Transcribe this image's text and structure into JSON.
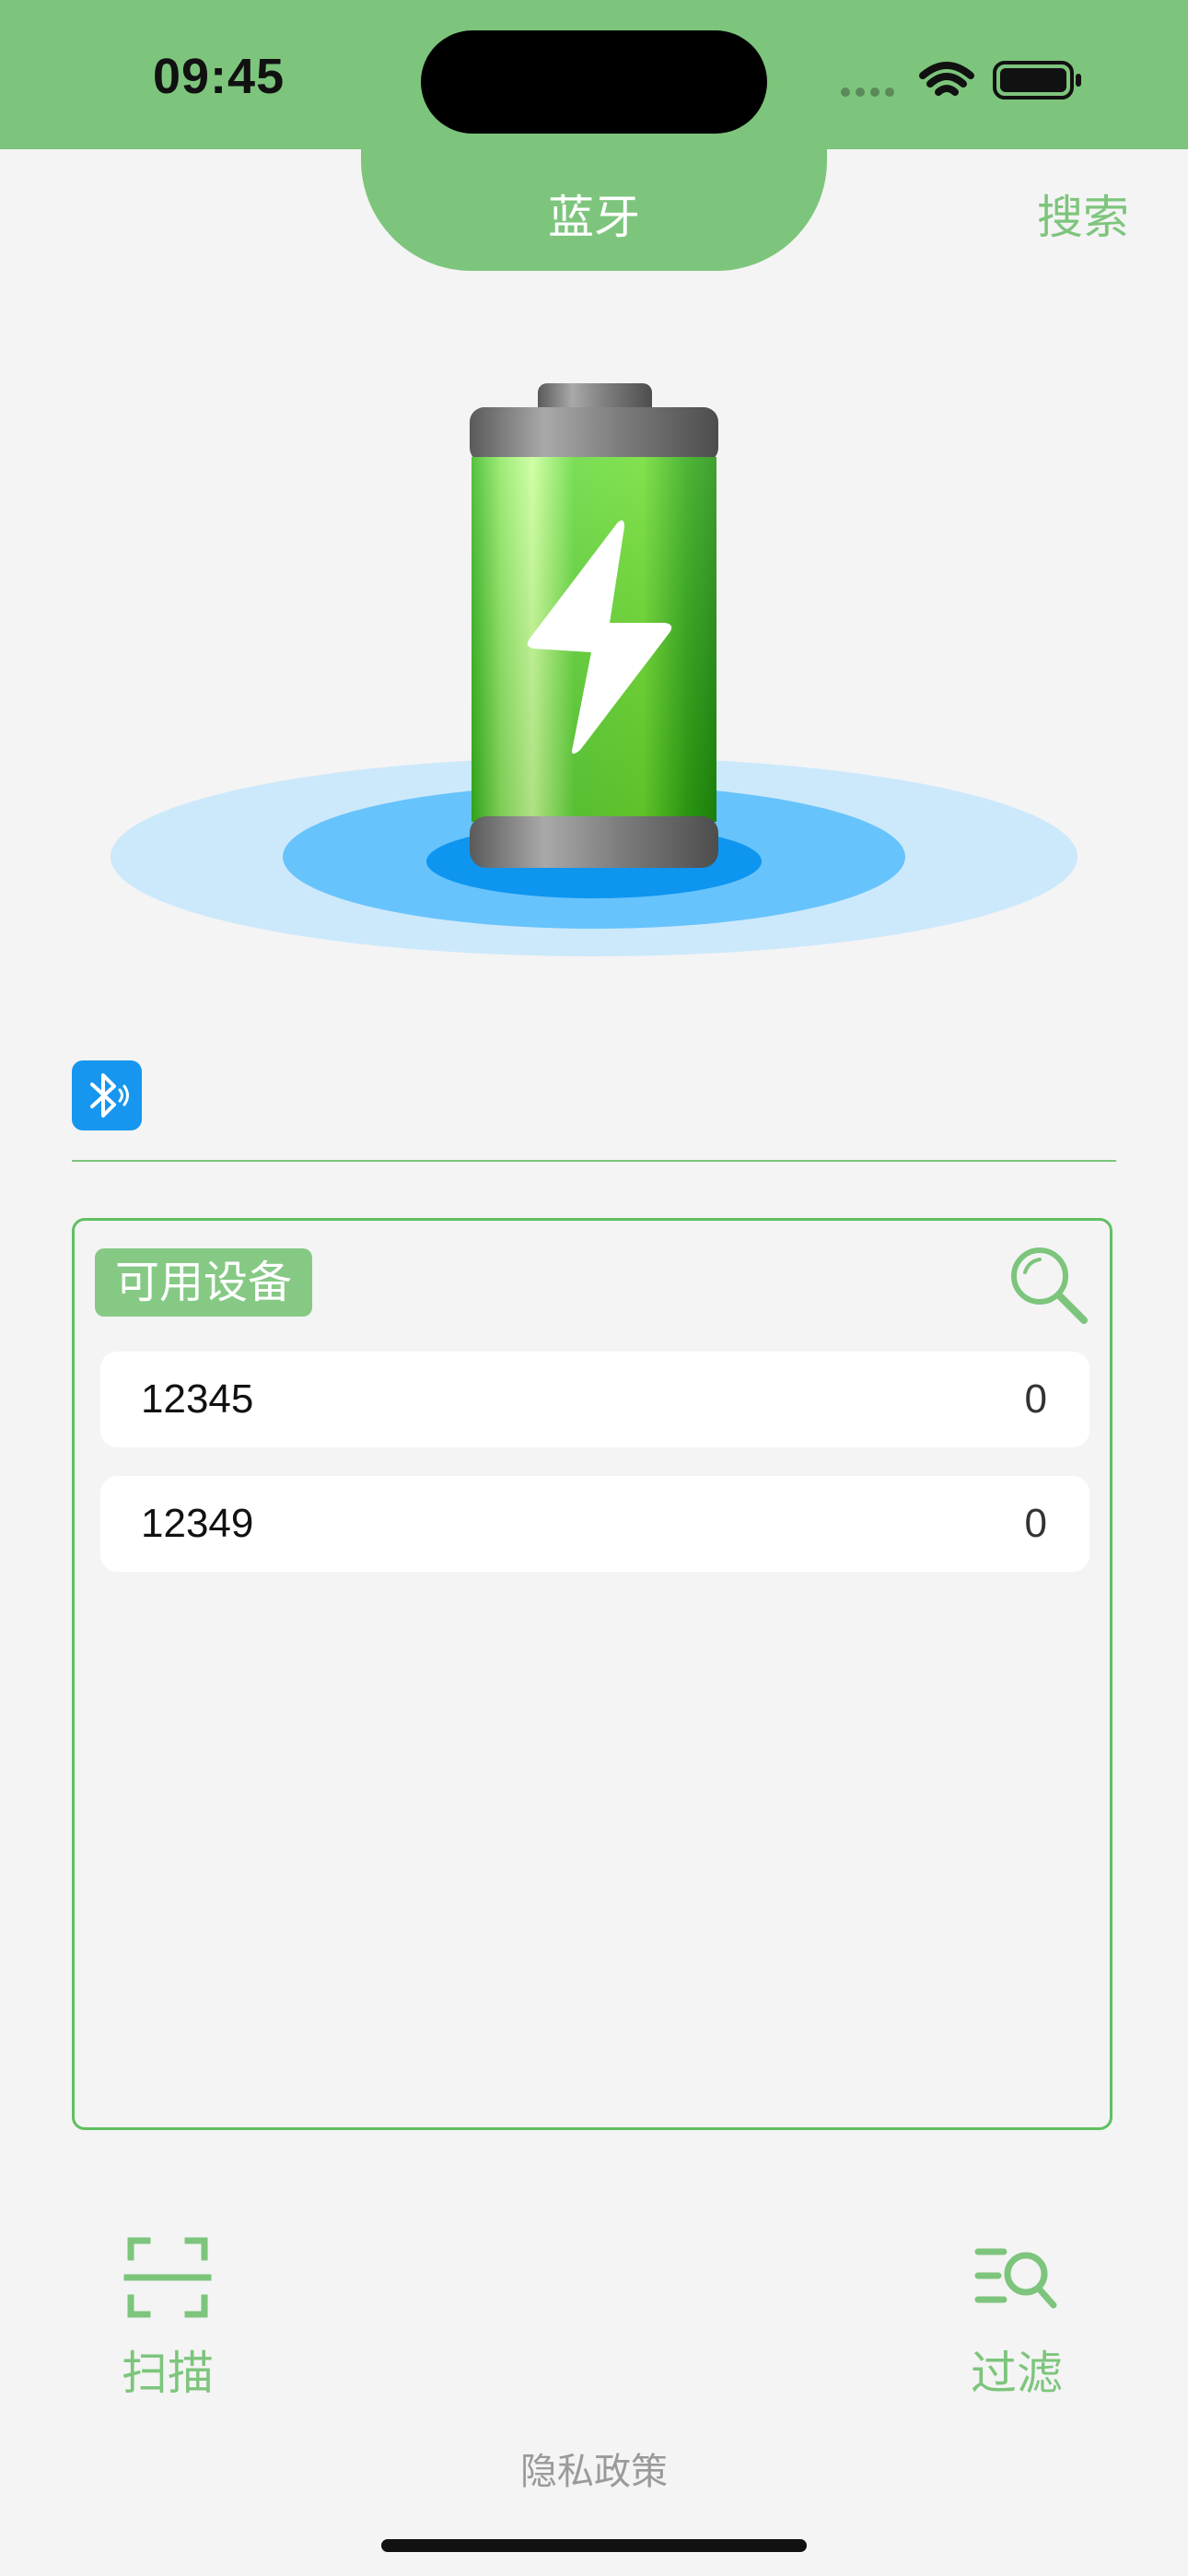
{
  "status_bar": {
    "time": "09:45"
  },
  "header": {
    "title": "蓝牙",
    "search_label": "搜索"
  },
  "device_panel": {
    "badge_label": "可用设备",
    "devices": [
      {
        "name": "12345",
        "value": "0"
      },
      {
        "name": "12349",
        "value": "0"
      }
    ]
  },
  "toolbar": {
    "scan_label": "扫描",
    "filter_label": "过滤"
  },
  "footer": {
    "privacy_label": "隐私政策"
  },
  "colors": {
    "accent_green": "#7dc57c",
    "bluetooth_blue": "#1796f0",
    "background": "#f4f4f4"
  },
  "icons": {
    "battery_illustration": "charging-battery-icon",
    "bluetooth": "bluetooth-icon",
    "panel_search": "search-icon",
    "scan": "scan-icon",
    "filter": "filter-search-icon"
  }
}
